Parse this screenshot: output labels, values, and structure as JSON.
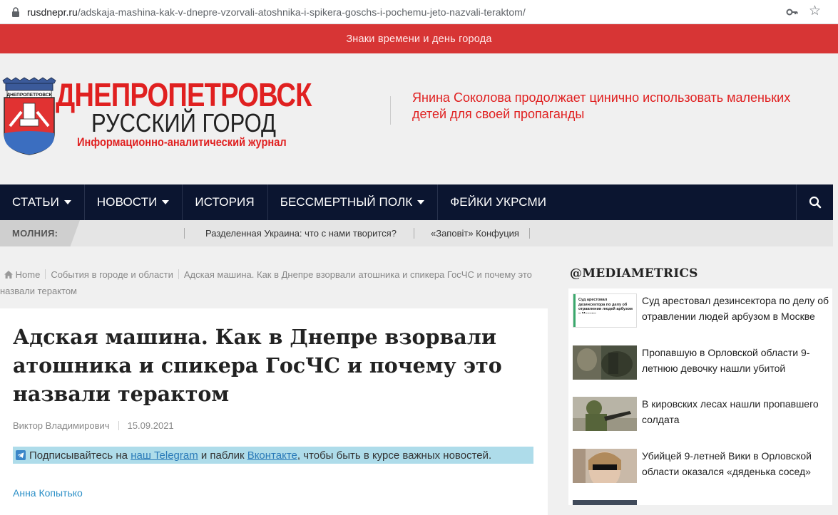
{
  "browser": {
    "url_host": "rusdnepr.ru",
    "url_path": "/adskaja-mashina-kak-v-dnepre-vzorvali-atoshnika-i-spikera-goschs-i-pochemu-jeto-nazvali-teraktom/"
  },
  "banner": {
    "text": "Знаки времени и день города"
  },
  "header": {
    "crest_label": "ДНЕПРОПЕТРОВСК",
    "logo_title": "ДНЕПРОПЕТРОВСК",
    "logo_subtitle": "РУССКИЙ ГОРОД",
    "logo_tagline": "Информационно-аналитический журнал",
    "headline": "Янина Соколова продолжает цинично использовать маленьких детей для своей пропаганды"
  },
  "nav": {
    "items": [
      {
        "label": "СТАТЬИ",
        "dropdown": true
      },
      {
        "label": "НОВОСТИ",
        "dropdown": true
      },
      {
        "label": "ИСТОРИЯ",
        "dropdown": false
      },
      {
        "label": "БЕССМЕРТНЫЙ ПОЛК",
        "dropdown": true
      },
      {
        "label": "ФЕЙКИ УКРСМИ",
        "dropdown": false
      }
    ]
  },
  "ticker": {
    "label": "МОЛНИЯ:",
    "items": [
      "Разделенная Украина: что с нами творится?",
      "«Заповіт» Конфуция"
    ]
  },
  "breadcrumb": {
    "home": "Home",
    "category": "События в городе и области",
    "current": "Адская машина. Как в Днепре взорвали атошника и спикера ГосЧС и почему это назвали терактом"
  },
  "article": {
    "title": "Адская машина. Как в Днепре взорвали атошника и спикера ГосЧС и почему это назвали терактом",
    "author_meta": "Виктор Владимирович",
    "date": "15.09.2021",
    "telegram": {
      "prefix": "Подписывайтесь на ",
      "link1": "наш Telegram",
      "middle": " и паблик ",
      "link2": "Вконтакте",
      "suffix": ", чтобы быть в курсе важных новостей."
    },
    "byline": "Анна Копытько"
  },
  "sidebar": {
    "title": "@MEDIAMETRICS",
    "items": [
      {
        "text": "Суд арестовал дезинсектора по делу об отравлении людей арбузом в Москве",
        "thumb_caption": "Суд арестовал дезинсектора по делу об отравлении людей арбузом в Москве"
      },
      {
        "text": "Пропавшую в Орловской области 9-летнюю девочку нашли убитой"
      },
      {
        "text": "В кировских лесах нашли пропавшего солдата"
      },
      {
        "text": "Убийцей 9-летней Вики в Орловской области оказался «дяденька сосед»"
      }
    ]
  },
  "colors": {
    "brand_red": "#e02020",
    "banner_red": "#d73535",
    "nav_bg": "#0b1530",
    "link_blue": "#2a7ab8",
    "telegram_bg": "#aedcea"
  }
}
